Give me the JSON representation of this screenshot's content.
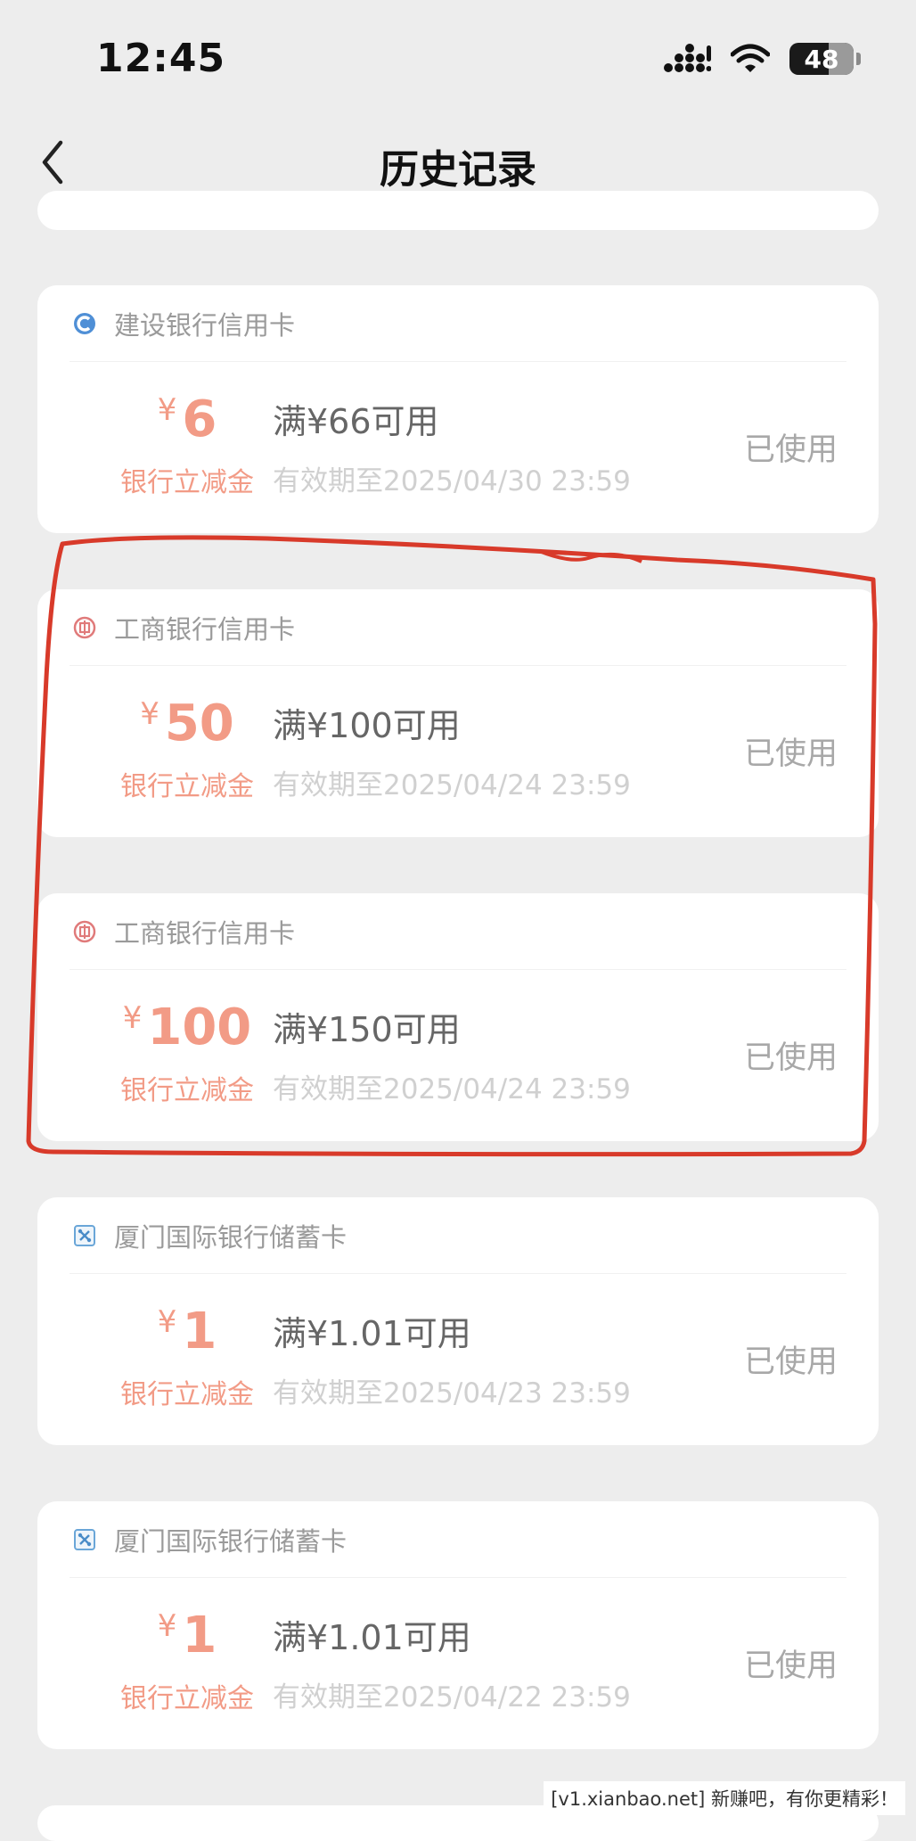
{
  "status_bar": {
    "time": "12:45",
    "battery": "48"
  },
  "nav": {
    "title": "历史记录",
    "back_icon": "chevron-left-icon"
  },
  "colors": {
    "accent": "#f29b86",
    "annotation": "#d83a2a"
  },
  "coupons": [
    {
      "bank": "建设银行信用卡",
      "bank_icon": "ccb-logo-icon",
      "currency": "¥",
      "amount": "6",
      "label": "银行立减金",
      "condition": "满¥66可用",
      "validity": "有效期至2025/04/30 23:59",
      "status": "已使用"
    },
    {
      "bank": "工商银行信用卡",
      "bank_icon": "icbc-logo-icon",
      "currency": "¥",
      "amount": "50",
      "label": "银行立减金",
      "condition": "满¥100可用",
      "validity": "有效期至2025/04/24 23:59",
      "status": "已使用"
    },
    {
      "bank": "工商银行信用卡",
      "bank_icon": "icbc-logo-icon",
      "currency": "¥",
      "amount": "100",
      "label": "银行立减金",
      "condition": "满¥150可用",
      "validity": "有效期至2025/04/24 23:59",
      "status": "已使用"
    },
    {
      "bank": "厦门国际银行储蓄卡",
      "bank_icon": "xib-logo-icon",
      "currency": "¥",
      "amount": "1",
      "label": "银行立减金",
      "condition": "满¥1.01可用",
      "validity": "有效期至2025/04/23 23:59",
      "status": "已使用"
    },
    {
      "bank": "厦门国际银行储蓄卡",
      "bank_icon": "xib-logo-icon",
      "currency": "¥",
      "amount": "1",
      "label": "银行立减金",
      "condition": "满¥1.01可用",
      "validity": "有效期至2025/04/22 23:59",
      "status": "已使用"
    }
  ],
  "watermark": "[v1.xianbao.net] 新赚吧，有你更精彩！"
}
